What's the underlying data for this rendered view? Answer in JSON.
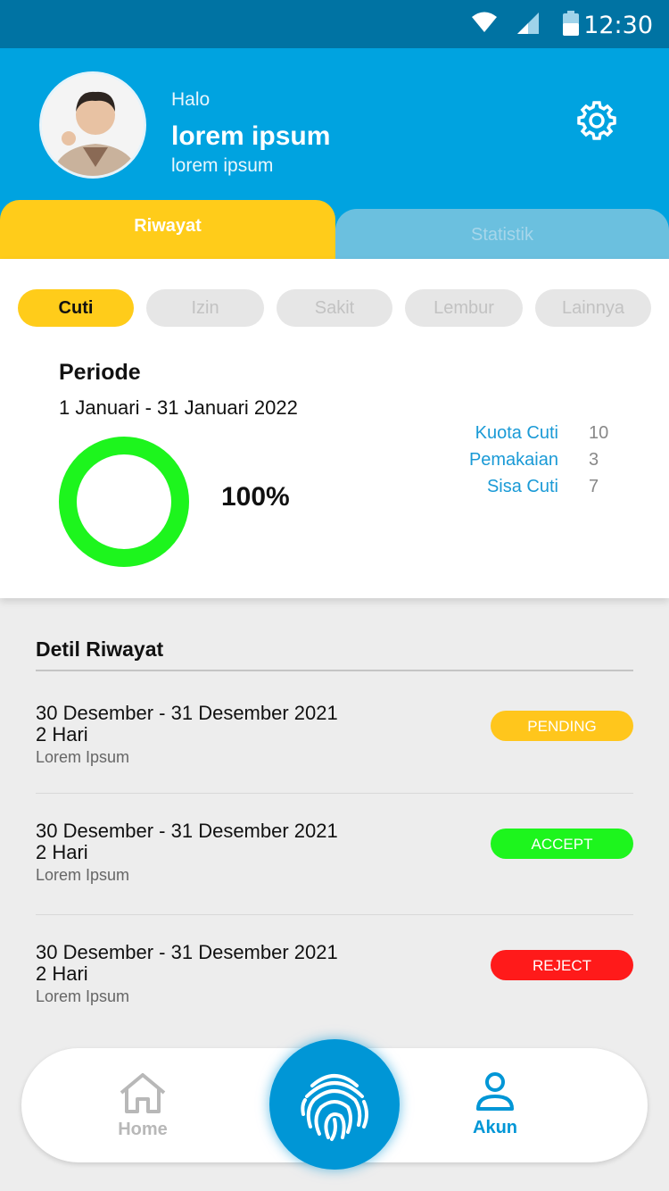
{
  "status_bar": {
    "time": "12:30",
    "icons": [
      "wifi-icon",
      "signal-icon",
      "battery-icon"
    ]
  },
  "header": {
    "greeting": "Halo",
    "name": "lorem ipsum",
    "subtitle": "lorem ipsum",
    "settings_icon": "gear-icon"
  },
  "tabs": [
    {
      "label": "Riwayat",
      "active": true
    },
    {
      "label": "Statistik",
      "active": false
    }
  ],
  "filters": [
    {
      "label": "Cuti",
      "active": true
    },
    {
      "label": "Izin",
      "active": false
    },
    {
      "label": "Sakit",
      "active": false
    },
    {
      "label": "Lembur",
      "active": false
    },
    {
      "label": "Lainnya",
      "active": false
    }
  ],
  "period": {
    "title": "Periode",
    "range": "1 Januari - 31 Januari 2022",
    "percent_label": "100%",
    "percent_value": 100
  },
  "stats": [
    {
      "label": "Kuota Cuti",
      "value": "10"
    },
    {
      "label": "Pemakaian",
      "value": "3"
    },
    {
      "label": "Sisa Cuti",
      "value": "7"
    }
  ],
  "detail": {
    "title": "Detil Riwayat",
    "rows": [
      {
        "dates": "30 Desember - 31 Desember 2021",
        "days": "2 Hari",
        "note": "Lorem Ipsum",
        "status": "PENDING",
        "status_color": "#ffc61c"
      },
      {
        "dates": "30 Desember - 31 Desember 2021",
        "days": "2 Hari",
        "note": "Lorem Ipsum",
        "status": "ACCEPT",
        "status_color": "#1df51d"
      },
      {
        "dates": "30 Desember - 31 Desember 2021",
        "days": "2 Hari",
        "note": "Lorem Ipsum",
        "status": "REJECT",
        "status_color": "#ff1a1a"
      }
    ]
  },
  "nav": {
    "home_label": "Home",
    "akun_label": "Akun",
    "fab_icon": "fingerprint-icon"
  },
  "colors": {
    "primary": "#00a3e0",
    "accent": "#ffcc1a",
    "donut": "#1df51d"
  }
}
